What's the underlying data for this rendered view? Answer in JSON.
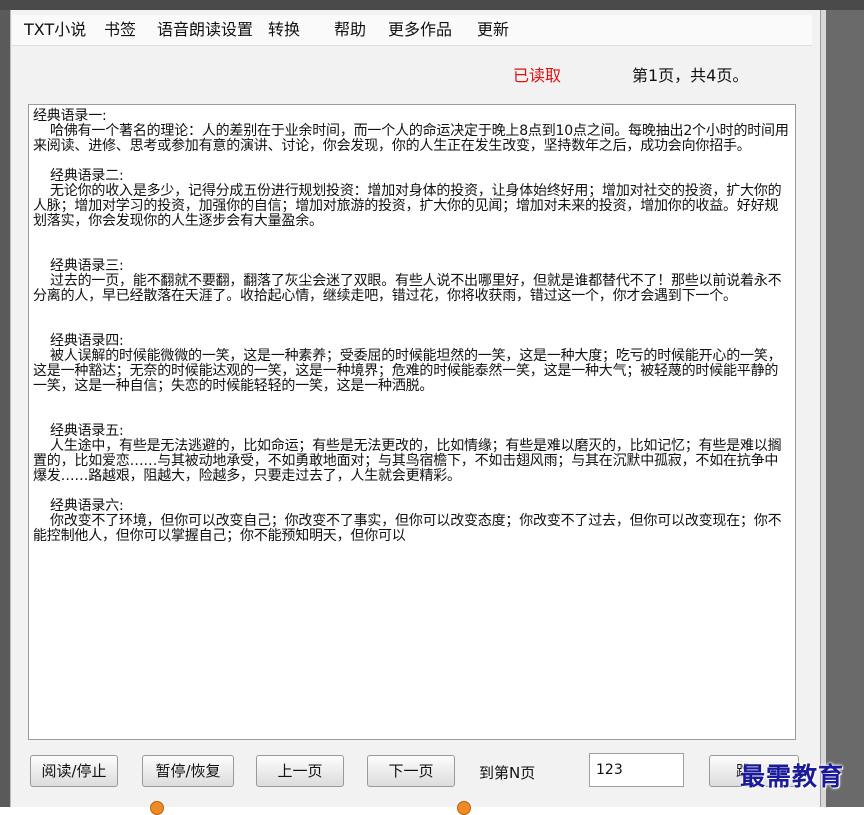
{
  "menu": {
    "items": [
      "TXT小说",
      "书签",
      "语音朗读设置",
      "转换",
      "帮助",
      "更多作品",
      "更新"
    ]
  },
  "status": {
    "read_state": "已读取",
    "page_info": "第1页，共4页。"
  },
  "content": {
    "paragraphs": [
      "经典语录一:\n    哈佛有一个著名的理论：人的差别在于业余时间，而一个人的命运决定于晚上8点到10点之间。每晚抽出2个小时的时间用来阅读、进修、思考或参加有意的演讲、讨论，你会发现，你的人生正在发生改变，坚持数年之后，成功会向你招手。",
      "    经典语录二:\n    无论你的收入是多少，记得分成五份进行规划投资：增加对身体的投资，让身体始终好用；增加对社交的投资，扩大你的人脉；增加对学习的投资，加强你的自信；增加对旅游的投资，扩大你的见闻；增加对未来的投资，增加你的收益。好好规划落实，你会发现你的人生逐步会有大量盈余。",
      "    经典语录三:\n    过去的一页，能不翻就不要翻，翻落了灰尘会迷了双眼。有些人说不出哪里好，但就是谁都替代不了！那些以前说着永不分离的人，早已经散落在天涯了。收拾起心情，继续走吧，错过花，你将收获雨，错过这一个，你才会遇到下一个。",
      "    经典语录四:\n    被人误解的时候能微微的一笑，这是一种素养；受委屈的时候能坦然的一笑，这是一种大度；吃亏的时候能开心的一笑，这是一种豁达；无奈的时候能达观的一笑，这是一种境界；危难的时候能泰然一笑，这是一种大气；被轻蔑的时候能平静的一笑，这是一种自信；失恋的时候能轻轻的一笑，这是一种洒脱。",
      "    经典语录五:\n    人生途中，有些是无法逃避的，比如命运；有些是无法更改的，比如情缘；有些是难以磨灭的，比如记忆；有些是难以搁置的，比如爱恋……与其被动地承受，不如勇敢地面对；与其鸟宿檐下，不如击翅风雨；与其在沉默中孤寂，不如在抗争中爆发……路越艰，阻越大，险越多，只要走过去了，人生就会更精彩。",
      "    经典语录六:\n    你改变不了环境，但你可以改变自己；你改变不了事实，但你可以改变态度；你改变不了过去，但你可以改变现在；你不能控制他人，但你可以掌握自己；你不能预知明天，但你可以"
    ]
  },
  "controls": {
    "read_stop": "阅读/停止",
    "pause_resume": "暂停/恢复",
    "prev_page": "上一页",
    "next_page": "下一页",
    "goto_label": "到第N页",
    "page_value": "123",
    "jump_partial": "跳"
  },
  "watermark": "最需教育",
  "colors": {
    "status_red": "#e01010",
    "radio_orange": "#f08a24",
    "watermark_blue": "#1b1b9a"
  }
}
